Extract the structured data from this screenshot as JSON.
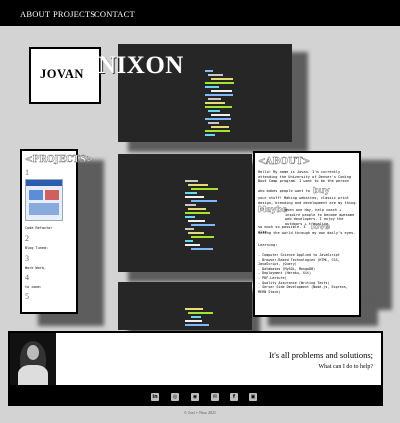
{
  "nav": {
    "items": [
      {
        "label": "ABOUT"
      },
      {
        "label": "PROJECTS"
      },
      {
        "label": "CONTACT"
      }
    ]
  },
  "hero": {
    "first_name": "JOVAN",
    "last_name": "NIXON"
  },
  "projects": {
    "title": "<PROJECTS>",
    "items": [
      {
        "number": "1",
        "label": "Code Refactor"
      },
      {
        "number": "2",
        "label": "Blog Tuned:"
      },
      {
        "number": "3",
        "label": "Work Work,"
      },
      {
        "number": "4",
        "label": "to come:"
      },
      {
        "number": "5",
        "label": ""
      }
    ]
  },
  "about": {
    "title": "<ABOUT>",
    "paragraphs": [
      "Hello! My name is Jovan. I'm currently attending the University of Denver's Coding Boot Camp program. I want to be the person",
      "who makes people want to",
      "buy",
      "your stuff! Making websites, classic print design, branding and development are my thing.",
      "Maybe",
      "even one day, help coach + inspire people to become awesome web developers. I enjoy the outdoors + traveling",
      "so much so possible. I also",
      "love",
      "seeing the world through my own daily’s eyes.",
      "Learning:"
    ],
    "learning": [
      "- Computer Science Applied to JavaScript",
      "- Browser-Based Technologies (HTML, CSS, JavaScript, jQuery)",
      "- Databases (MySQL, MongoDB)",
      "- Deployment (Heroku, Git)",
      "- PDF-Lecture)",
      "- Quality Assurance (Writing Tests)",
      "- Server Side Development (Node.js, Express, MERN Stack)"
    ]
  },
  "banner": {
    "quote": "It's all problems and solutions;",
    "question": "What can I do to help?"
  },
  "footer": {
    "icons": [
      {
        "name": "linkedin-icon",
        "glyph": "in"
      },
      {
        "name": "github-icon",
        "glyph": "◎"
      },
      {
        "name": "spotify-icon",
        "glyph": "◉"
      },
      {
        "name": "twitter-icon",
        "glyph": "✉"
      },
      {
        "name": "facebook-icon",
        "glyph": "f"
      },
      {
        "name": "portfolio-icon",
        "glyph": "▣"
      }
    ],
    "copyright": "© Jovi + Nixo 2021"
  }
}
